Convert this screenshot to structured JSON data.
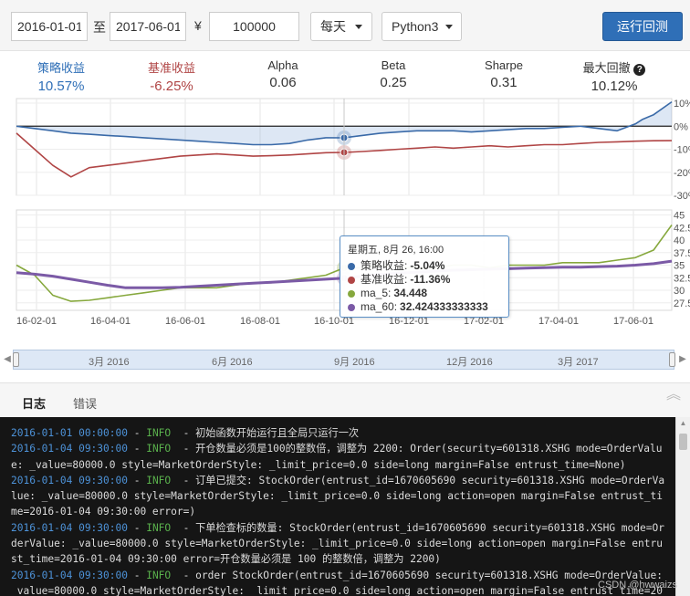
{
  "toolbar": {
    "start_date": "2016-01-01",
    "to_label": "至",
    "end_date": "2017-06-01",
    "currency_symbol": "¥",
    "capital": "100000",
    "frequency": "每天",
    "python_version": "Python3",
    "run_button": "运行回测"
  },
  "stats": [
    {
      "label": "策略收益",
      "value": "10.57%",
      "color": "#2f6fb7"
    },
    {
      "label": "基准收益",
      "value": "-6.25%",
      "color": "#b04545"
    },
    {
      "label": "Alpha",
      "value": "0.06",
      "color": "#333333"
    },
    {
      "label": "Beta",
      "value": "0.25",
      "color": "#333333"
    },
    {
      "label": "Sharpe",
      "value": "0.31",
      "color": "#333333"
    },
    {
      "label": "最大回撤",
      "value": "10.12%",
      "color": "#333333",
      "icon": "help-icon"
    }
  ],
  "chart_data": [
    {
      "type": "line",
      "y_tick_labels": [
        "10%",
        "0%",
        "-10%",
        "-20%",
        "-30%"
      ],
      "ylim": [
        -30,
        12
      ],
      "series": [
        {
          "name": "策略收益",
          "color": "#3a6aa8",
          "x": [
            0,
            10,
            20,
            30,
            40,
            50,
            60,
            70,
            80,
            90,
            100,
            110,
            120,
            130,
            140,
            150,
            160,
            170,
            180,
            190,
            200,
            210,
            220,
            230,
            240,
            250,
            260,
            270,
            280,
            290,
            300,
            310,
            320,
            330,
            340,
            344,
            350,
            360
          ],
          "values": [
            0,
            -1,
            -2,
            -3,
            -3.5,
            -4,
            -4.5,
            -5,
            -5.5,
            -6,
            -6.5,
            -7,
            -7.5,
            -8,
            -8,
            -7.5,
            -6,
            -5,
            -5.04,
            -4,
            -3,
            -2.5,
            -2,
            -2,
            -2,
            -2.5,
            -2,
            -1.5,
            -1,
            -1,
            -0.5,
            0,
            -1,
            -2,
            1,
            3,
            5,
            10.57
          ]
        },
        {
          "name": "基准收益",
          "color": "#b04545",
          "x": [
            0,
            10,
            20,
            30,
            40,
            50,
            60,
            70,
            80,
            90,
            100,
            110,
            120,
            130,
            140,
            150,
            160,
            170,
            180,
            190,
            200,
            210,
            220,
            230,
            240,
            250,
            260,
            270,
            280,
            290,
            300,
            310,
            320,
            330,
            340,
            350,
            360
          ],
          "values": [
            -3,
            -10,
            -17,
            -22,
            -18,
            -17,
            -16,
            -15,
            -14,
            -13,
            -12.5,
            -12,
            -12.5,
            -13,
            -12.8,
            -12.5,
            -12,
            -11.5,
            -11.36,
            -11,
            -10.5,
            -10,
            -9.5,
            -9,
            -9.5,
            -9,
            -8.5,
            -9,
            -8.5,
            -8,
            -8,
            -7.5,
            -7,
            -6.8,
            -6.5,
            -6.3,
            -6.25
          ]
        }
      ],
      "hover_x": 180
    },
    {
      "type": "line",
      "y_tick_labels": [
        "45",
        "42.5",
        "40",
        "37.5",
        "35",
        "32.5",
        "30",
        "27.5"
      ],
      "ylim": [
        26,
        46
      ],
      "x_tick_labels": [
        "16-02-01",
        "16-04-01",
        "16-06-01",
        "16-08-01",
        "16-10-01",
        "16-12-01",
        "17-02-01",
        "17-04-01",
        "17-06-01"
      ],
      "series": [
        {
          "name": "ma_5",
          "color": "#86a83d",
          "x": [
            0,
            10,
            20,
            30,
            40,
            50,
            60,
            70,
            80,
            90,
            100,
            110,
            120,
            130,
            140,
            150,
            160,
            170,
            180,
            190,
            200,
            210,
            220,
            230,
            240,
            250,
            260,
            270,
            280,
            290,
            300,
            310,
            320,
            330,
            340,
            350,
            360
          ],
          "values": [
            35,
            33,
            29,
            27.8,
            28,
            28.5,
            29,
            29.5,
            30,
            30.5,
            30.5,
            30.5,
            31,
            31.5,
            31.5,
            32,
            32.5,
            33,
            34.448,
            34.5,
            35,
            34.5,
            34.5,
            34.5,
            35,
            35,
            34.5,
            35,
            35,
            35,
            35.5,
            35.5,
            35.5,
            36,
            36.5,
            38,
            43
          ]
        },
        {
          "name": "ma_60",
          "color": "#7b5aa6",
          "x": [
            0,
            10,
            20,
            30,
            40,
            50,
            60,
            70,
            80,
            90,
            100,
            110,
            120,
            130,
            140,
            150,
            160,
            170,
            180,
            190,
            200,
            210,
            220,
            230,
            240,
            250,
            260,
            270,
            280,
            290,
            300,
            310,
            320,
            330,
            340,
            350,
            360
          ],
          "values": [
            33.5,
            33.2,
            32.8,
            32.2,
            31.6,
            31,
            30.5,
            30.5,
            30.5,
            30.6,
            30.8,
            31,
            31.2,
            31.4,
            31.6,
            31.8,
            32,
            32.2,
            32.424333333333,
            32.8,
            33.1,
            33.4,
            33.6,
            33.8,
            34,
            34.1,
            34.2,
            34.3,
            34.4,
            34.5,
            34.6,
            34.6,
            34.7,
            34.8,
            35,
            35.3,
            35.8
          ]
        }
      ]
    }
  ],
  "tooltip": {
    "title": "星期五, 8月 26, 16:00",
    "rows": [
      {
        "label": "策略收益:",
        "value": "-5.04%",
        "color": "#3a6aa8"
      },
      {
        "label": "基准收益:",
        "value": "-11.36%",
        "color": "#b04545"
      },
      {
        "label": "ma_5:",
        "value": "34.448",
        "color": "#86a83d"
      },
      {
        "label": "ma_60:",
        "value": "32.424333333333",
        "color": "#7b5aa6"
      }
    ]
  },
  "navigator": {
    "labels": [
      "3月 2016",
      "6月 2016",
      "9月 2016",
      "12月 2016",
      "3月 2017"
    ]
  },
  "log_tabs": {
    "log": "日志",
    "error": "错误"
  },
  "logs": [
    {
      "time": "2016-01-01 00:00:00",
      "level": "INFO",
      "msg": "初始函数开始运行且全局只运行一次"
    },
    {
      "time": "2016-01-04 09:30:00",
      "level": "INFO",
      "msg": "开仓数量必须是100的整数倍，调整为 2200: Order(security=601318.XSHG mode=OrderValue: _value=80000.0 style=MarketOrderStyle: _limit_price=0.0 side=long margin=False entrust_time=None)"
    },
    {
      "time": "2016-01-04 09:30:00",
      "level": "INFO",
      "msg": "订单已提交: StockOrder(entrust_id=1670605690 security=601318.XSHG mode=OrderValue: _value=80000.0 style=MarketOrderStyle: _limit_price=0.0 side=long action=open margin=False entrust_time=2016-01-04 09:30:00 error=)"
    },
    {
      "time": "2016-01-04 09:30:00",
      "level": "INFO",
      "msg": "下单检查标的数量: StockOrder(entrust_id=1670605690 security=601318.XSHG mode=OrderValue: _value=80000.0 style=MarketOrderStyle: _limit_price=0.0 side=long action=open margin=False entrust_time=2016-01-04 09:30:00 error=开仓数量必须是 100 的整数倍，调整为 2200)"
    },
    {
      "time": "2016-01-04 09:30:00",
      "level": "INFO",
      "msg": "order StockOrder(entrust_id=1670605690 security=601318.XSHG mode=OrderValue: _value=80000.0 style=MarketOrderStyle: _limit_price=0.0 side=long action=open margin=False entrust_time=2016-"
    }
  ],
  "watermark": "CSDN @hwwaizs"
}
